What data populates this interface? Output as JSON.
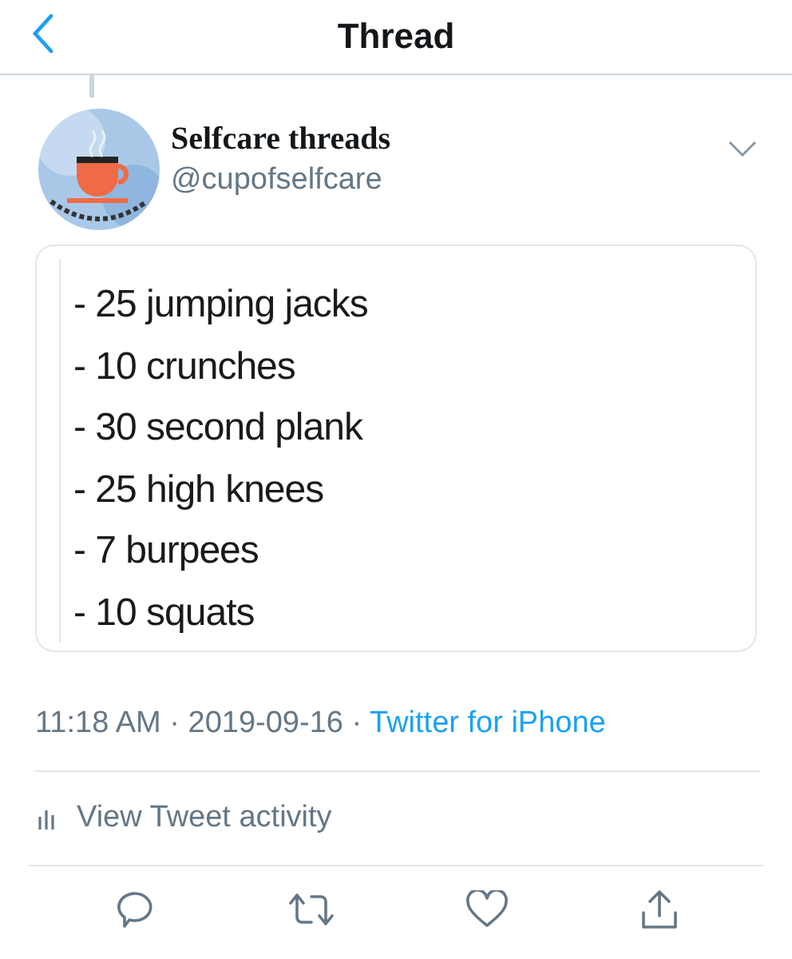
{
  "header": {
    "title": "Thread"
  },
  "tweet": {
    "author": {
      "name": "Selfcare threads",
      "handle": "@cupofselfcare"
    },
    "note_lines": [
      "- 25 jumping jacks",
      "- 10 crunches",
      "- 30 second plank",
      "- 25 high knees",
      "- 7 burpees",
      "- 10 squats"
    ],
    "time": "11:18 AM",
    "separator_1": "·",
    "date": "2019-09-16",
    "separator_2": "·",
    "source": "Twitter for iPhone"
  },
  "activity": {
    "label": "View Tweet activity"
  }
}
